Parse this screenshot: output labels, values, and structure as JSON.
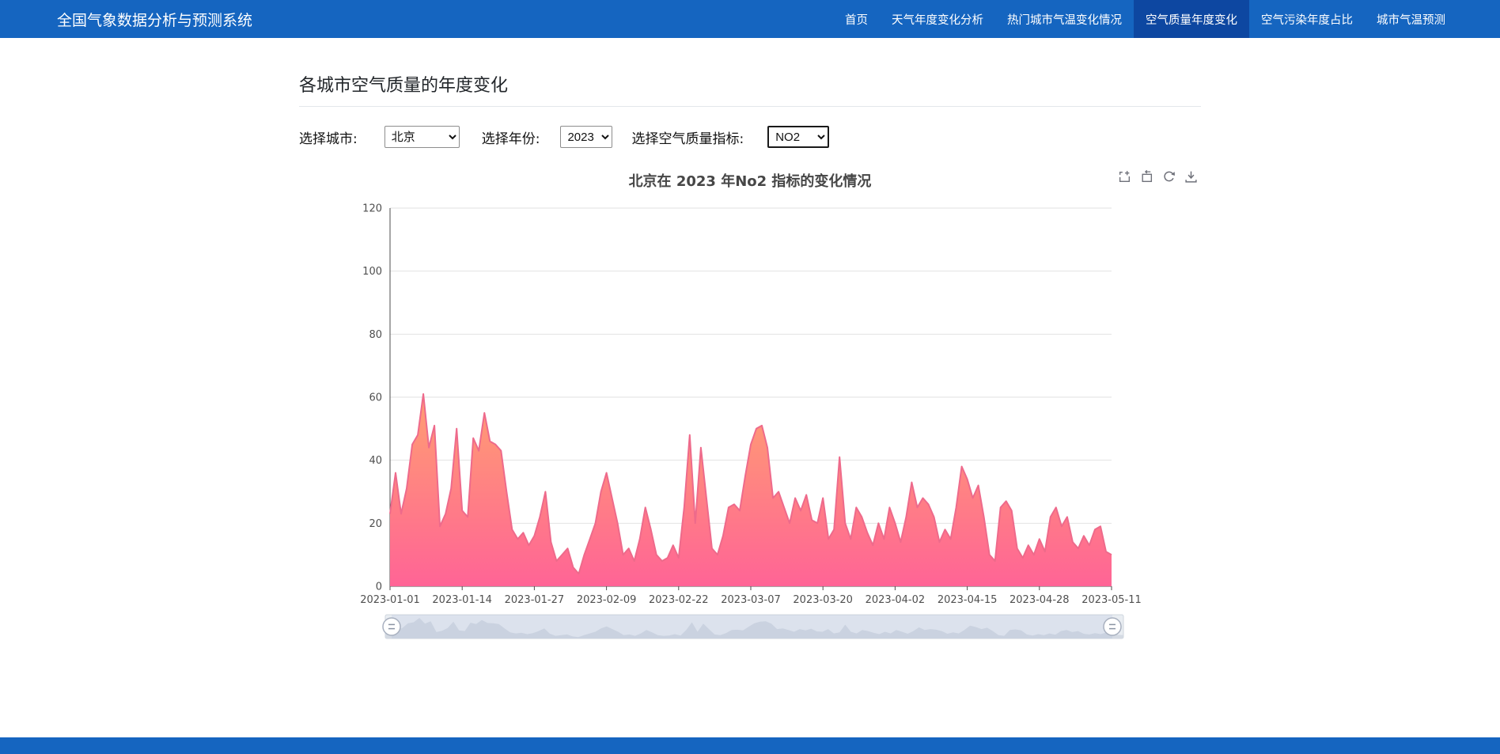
{
  "navbar": {
    "brand": "全国气象数据分析与预测系统",
    "items": [
      {
        "label": "首页",
        "active": false
      },
      {
        "label": "天气年度变化分析",
        "active": false
      },
      {
        "label": "热门城市气温变化情况",
        "active": false
      },
      {
        "label": "空气质量年度变化",
        "active": true
      },
      {
        "label": "空气污染年度占比",
        "active": false
      },
      {
        "label": "城市气温预测",
        "active": false
      }
    ]
  },
  "page": {
    "title": "各城市空气质量的年度变化"
  },
  "filters": {
    "city": {
      "label": "选择城市:",
      "value": "北京"
    },
    "year": {
      "label": "选择年份:",
      "value": "2023"
    },
    "indicator": {
      "label": "选择空气质量指标:",
      "value": "NO2"
    }
  },
  "toolbox": {
    "icons": [
      "zoom-select-icon",
      "zoom-reset-icon",
      "restore-icon",
      "download-icon"
    ],
    "icon_color": "#6e7079"
  },
  "chart_data": {
    "type": "area",
    "title": "北京在 2023 年No2 指标的变化情况",
    "xlabel": "",
    "ylabel": "",
    "ylim": [
      0,
      120
    ],
    "y_ticks": [
      0,
      20,
      40,
      60,
      80,
      100,
      120
    ],
    "x_tick_labels": [
      "2023-01-01",
      "2023-01-14",
      "2023-01-27",
      "2023-02-09",
      "2023-02-22",
      "2023-03-07",
      "2023-03-20",
      "2023-04-02",
      "2023-04-15",
      "2023-04-28",
      "2023-05-11"
    ],
    "x_tick_indices": [
      0,
      13,
      26,
      39,
      52,
      65,
      78,
      91,
      104,
      117,
      130
    ],
    "grid": true,
    "legend": "none",
    "datazoom_slider": {
      "range": [
        0,
        100
      ]
    },
    "series": [
      {
        "name": "NO2",
        "values": [
          23,
          36,
          23,
          31,
          45,
          48,
          61,
          44,
          51,
          19,
          23,
          31,
          50,
          24,
          22,
          47,
          43,
          55,
          46,
          45,
          43,
          30,
          18,
          15,
          17,
          13,
          16,
          22,
          30,
          14,
          8,
          10,
          12,
          6,
          4,
          10,
          15,
          20,
          30,
          36,
          28,
          20,
          10,
          12,
          8,
          15,
          25,
          18,
          10,
          8,
          9,
          13,
          9,
          25,
          48,
          20,
          44,
          28,
          12,
          10,
          16,
          25,
          26,
          24,
          35,
          45,
          50,
          51,
          44,
          28,
          30,
          25,
          20,
          28,
          24,
          29,
          21,
          20,
          28,
          15,
          18,
          41,
          20,
          15,
          25,
          22,
          17,
          13,
          20,
          15,
          25,
          20,
          14,
          22,
          33,
          25,
          28,
          26,
          22,
          14,
          18,
          15,
          25,
          38,
          34,
          28,
          32,
          22,
          10,
          8,
          25,
          27,
          24,
          12,
          9,
          13,
          10,
          15,
          11,
          22,
          25,
          19,
          22,
          14,
          12,
          16,
          13,
          18,
          19,
          11,
          10
        ]
      }
    ],
    "colors": {
      "line": "#ee6a8b",
      "fill_top": "#ffa071",
      "fill_mid": "#ff7f85",
      "fill_bottom": "#ff6496",
      "axis": "#4d4d4d",
      "gridline": "#e2e2e2",
      "tick_text": "#4f4f4f"
    }
  },
  "theme": {
    "navbar_bg": "#1565c0",
    "navbar_active_bg": "#0d47a1",
    "footer_bg": "#1565c0"
  }
}
